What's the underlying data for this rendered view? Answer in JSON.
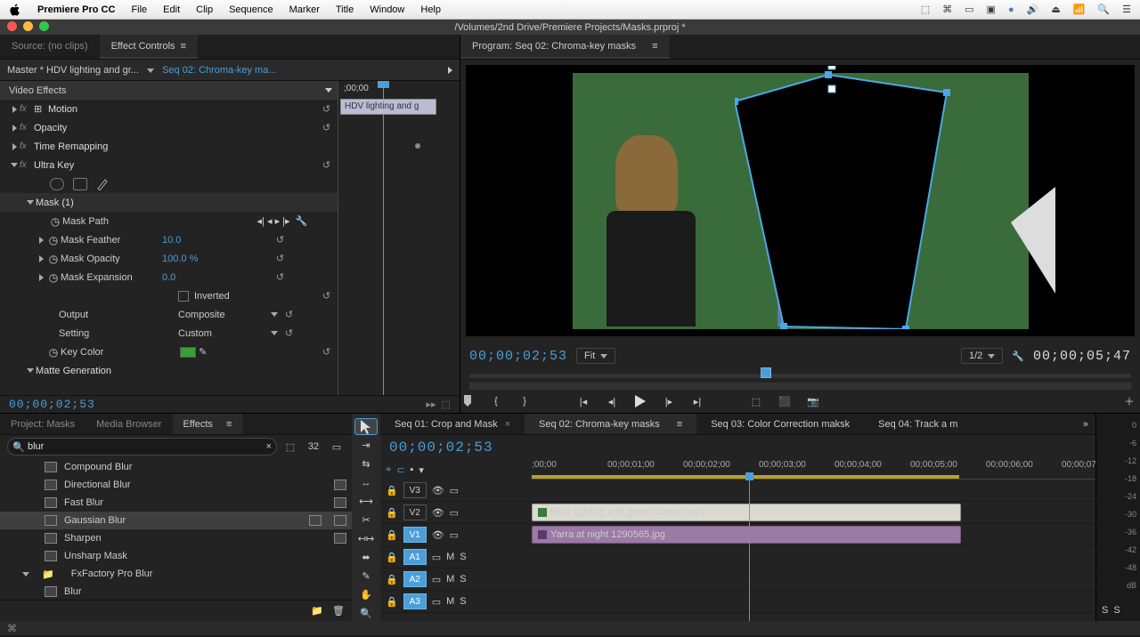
{
  "menubar": {
    "app": "Premiere Pro CC",
    "items": [
      "File",
      "Edit",
      "Clip",
      "Sequence",
      "Marker",
      "Title",
      "Window",
      "Help"
    ]
  },
  "titlebar": "/Volumes/2nd Drive/Premiere Projects/Masks.prproj *",
  "ec": {
    "source_tab": "Source: (no clips)",
    "controls_tab": "Effect Controls",
    "master": "Master * HDV lighting and gr...",
    "seq": "Seq 02: Chroma-key ma...",
    "tc": "00;00;02;53",
    "section": "Video Effects",
    "motion": "Motion",
    "opacity": "Opacity",
    "time_remap": "Time Remapping",
    "ultra": "Ultra Key",
    "mask": "Mask (1)",
    "mask_path": "Mask Path",
    "mask_feather": "Mask Feather",
    "feather_val": "10.0",
    "mask_opacity": "Mask Opacity",
    "opacity_val": "100.0 %",
    "mask_exp": "Mask Expansion",
    "exp_val": "0.0",
    "inverted": "Inverted",
    "output": "Output",
    "output_val": "Composite",
    "setting": "Setting",
    "setting_val": "Custom",
    "key_color": "Key Color",
    "matte": "Matte Generation",
    "miniclip": "HDV lighting and g",
    "miniruler": ";00;00"
  },
  "program": {
    "tab": "Program:  Seq 02: Chroma-key masks",
    "tc": "00;00;02;53",
    "fit": "Fit",
    "res": "1/2",
    "dur": "00;00;05;47"
  },
  "proj": {
    "tabs": {
      "project": "Project: Masks",
      "media": "Media Browser",
      "effects": "Effects"
    },
    "search": "blur",
    "items": [
      "Compound Blur",
      "Directional Blur",
      "Fast Blur",
      "Gaussian Blur",
      "Sharpen",
      "Unsharp Mask"
    ],
    "folder": "FxFactory Pro Blur",
    "sub": "Blur"
  },
  "timeline": {
    "tabs": [
      "Seq 01: Crop and Mask",
      "Seq 02: Chroma-key masks",
      "Seq 03: Color Correction maksk",
      "Seq 04: Track a m"
    ],
    "tc": "00;00;02;53",
    "ruler": [
      ";00;00",
      "00;00;01;00",
      "00;00;02;00",
      "00;00;03;00",
      "00;00;04;00",
      "00;00;05;00",
      "00;00;06;00",
      "00;00;07"
    ],
    "tracks": {
      "v3": "V3",
      "v2": "V2",
      "v1": "V1",
      "a1": "A1",
      "a2": "A2",
      "a3": "A3"
    },
    "clip_v2": "HDV lighting and green screen.mov",
    "clip_v1": "Yarra at night 1290565.jpg",
    "m": "M",
    "s": "S"
  },
  "meters": {
    "labels": [
      "0",
      "-6",
      "-12",
      "-18",
      "-24",
      "-30",
      "-36",
      "-42",
      "-48",
      "dB"
    ],
    "btm": [
      "S",
      "S"
    ]
  }
}
